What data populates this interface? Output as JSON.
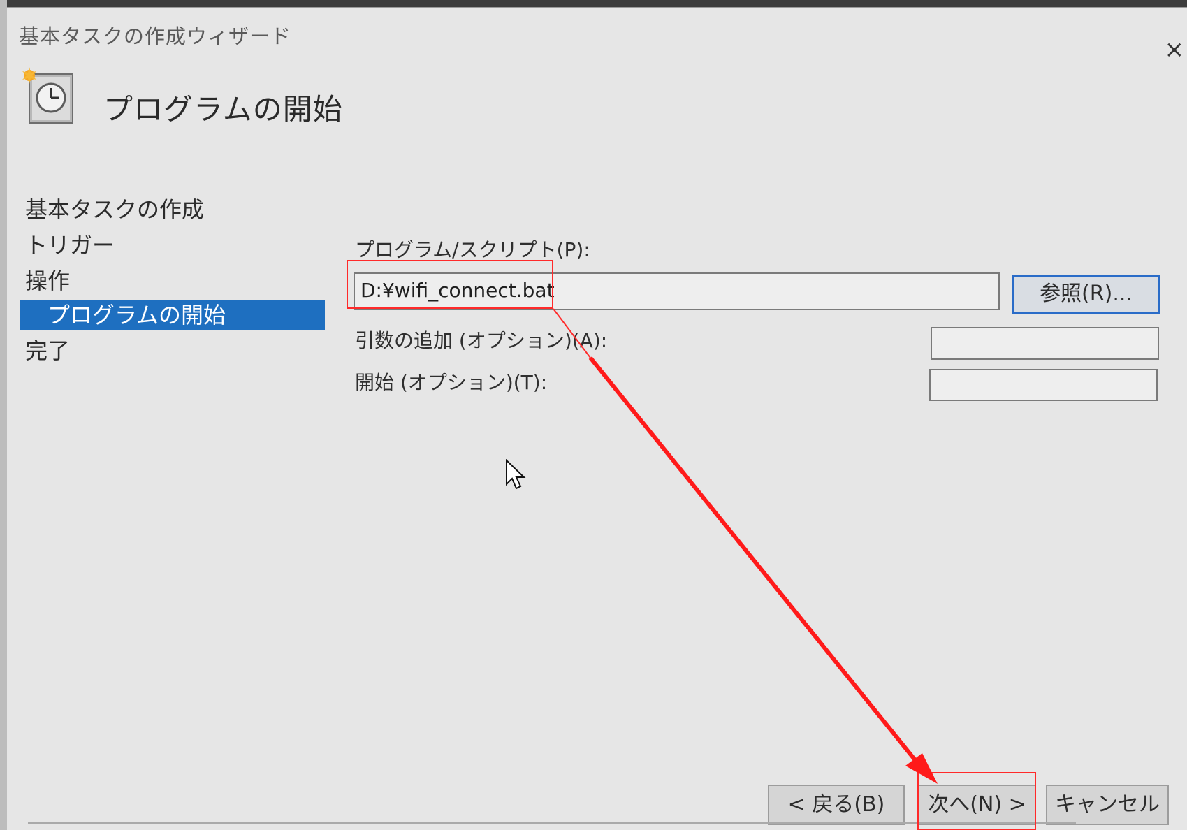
{
  "window": {
    "title": "基本タスクの作成ウィザード",
    "close_label": "×"
  },
  "header": {
    "icon": "task-scheduler-clock-icon",
    "title": "プログラムの開始"
  },
  "steps": [
    {
      "label": "基本タスクの作成",
      "active": false
    },
    {
      "label": "トリガー",
      "active": false
    },
    {
      "label": "操作",
      "active": false
    },
    {
      "label": "プログラムの開始",
      "active": true
    },
    {
      "label": "完了",
      "active": false
    }
  ],
  "form": {
    "program_label": "プログラム/スクリプト(P):",
    "program_value": "D:¥wifi_connect.bat",
    "browse_label": "参照(R)...",
    "args_label": "引数の追加 (オプション)(A):",
    "args_value": "",
    "start_label": "開始 (オプション)(T):",
    "start_value": ""
  },
  "footer": {
    "back_label": "< 戻る(B)",
    "next_label": "次へ(N) >",
    "cancel_label": "キャンセル"
  },
  "annotation": {
    "highlight_color": "#ff2a2a",
    "arrow_color": "#ff1a1a"
  },
  "colors": {
    "selection": "#1e6fc0",
    "browse_border": "#2a6cc8"
  }
}
